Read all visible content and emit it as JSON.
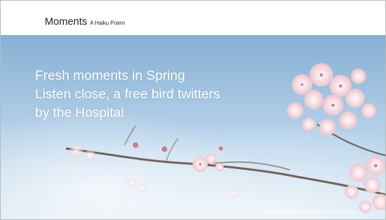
{
  "slide": {
    "title": "Moments",
    "subtitle": "A Haiku Poem",
    "poem_lines": [
      "Fresh moments in Spring",
      "Listen close, a free bird twitters",
      "by the Hospital"
    ],
    "credit": "Arts celebrating Poetry Day Ireland 2021"
  },
  "image": {
    "subject": "cherry-blossom-branch",
    "sky_colors": [
      "#8fb6d6",
      "#bcd6ea",
      "#e2eef7"
    ],
    "blossom_color": "#f5d3d8"
  }
}
